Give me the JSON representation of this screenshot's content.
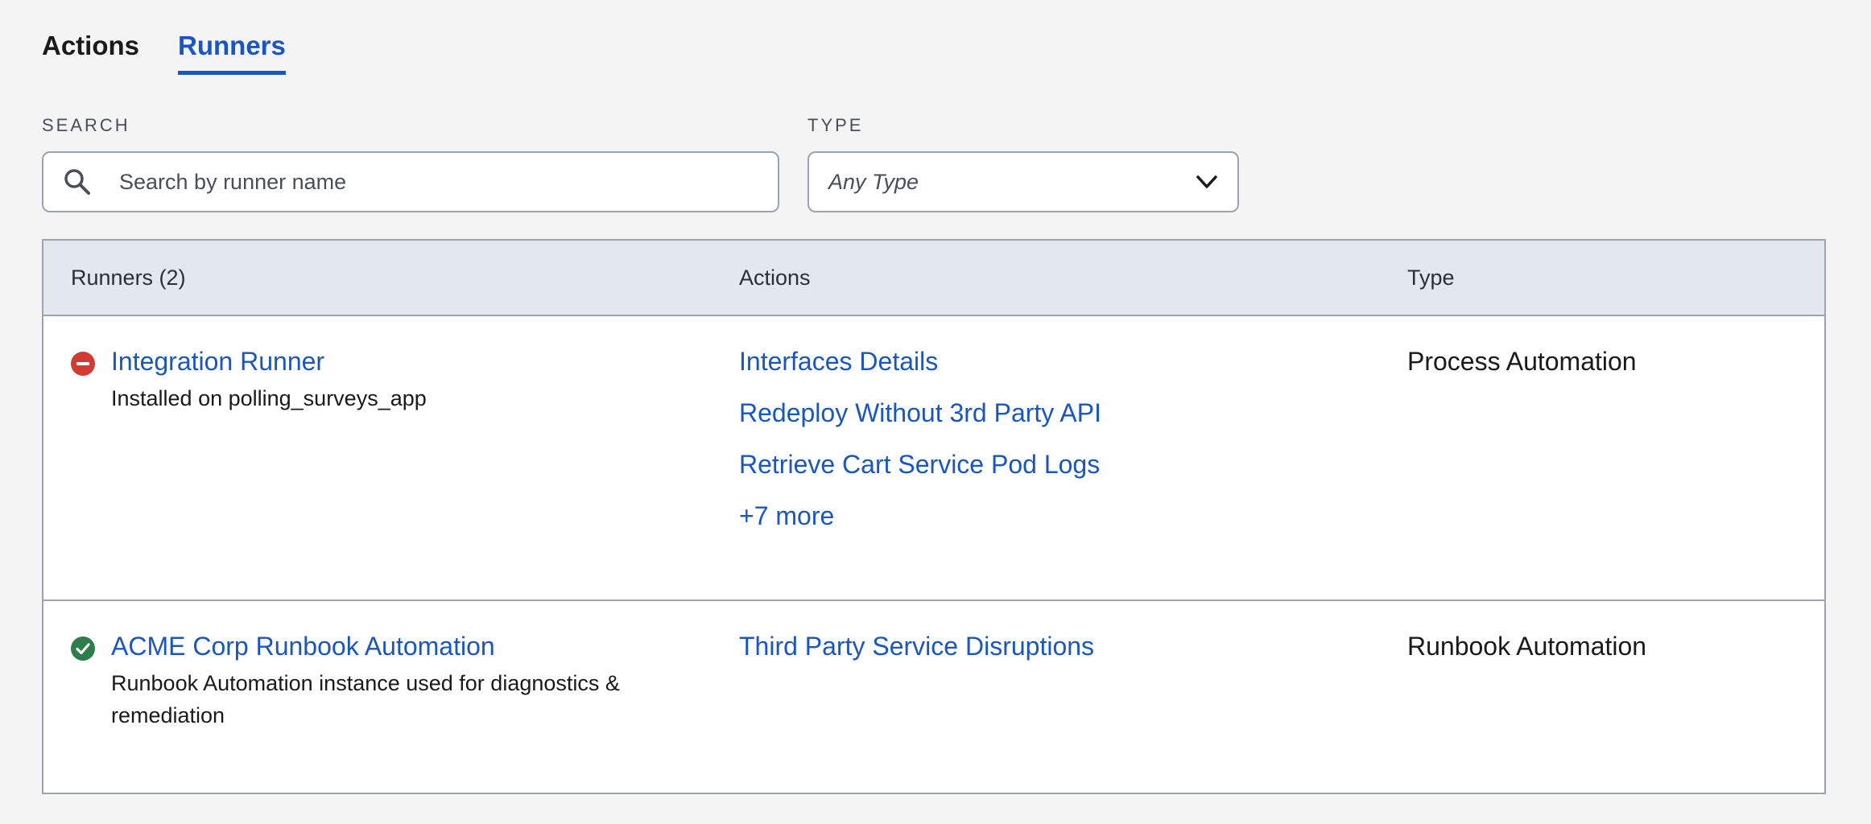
{
  "tabs": [
    {
      "label": "Actions",
      "active": false
    },
    {
      "label": "Runners",
      "active": true
    }
  ],
  "filters": {
    "search": {
      "label": "SEARCH",
      "placeholder": "Search by runner name",
      "value": "",
      "icon": "search-icon"
    },
    "type": {
      "label": "TYPE",
      "value": "Any Type",
      "icon": "chevron-down-icon"
    }
  },
  "table": {
    "headers": {
      "runners": "Runners (2)",
      "actions": "Actions",
      "type": "Type"
    },
    "rows": [
      {
        "status": "error",
        "status_icon": "minus-circle-icon",
        "name": "Integration Runner",
        "description": "Installed on polling_surveys_app",
        "actions": [
          "Interfaces Details",
          "Redeploy Without 3rd Party API",
          "Retrieve Cart Service Pod Logs"
        ],
        "more": "+7 more",
        "type": "Process Automation"
      },
      {
        "status": "ok",
        "status_icon": "check-circle-icon",
        "name": "ACME Corp Runbook Automation",
        "description": "Runbook Automation instance used for diagnostics & remediation",
        "actions": [
          "Third Party Service Disruptions"
        ],
        "type": "Runbook Automation"
      }
    ]
  },
  "colors": {
    "accent": "#1a56c2",
    "error": "#d23b34",
    "success": "#2f7d4a",
    "header_bg": "#e3e8ef",
    "page_bg": "#f4f4f4"
  }
}
